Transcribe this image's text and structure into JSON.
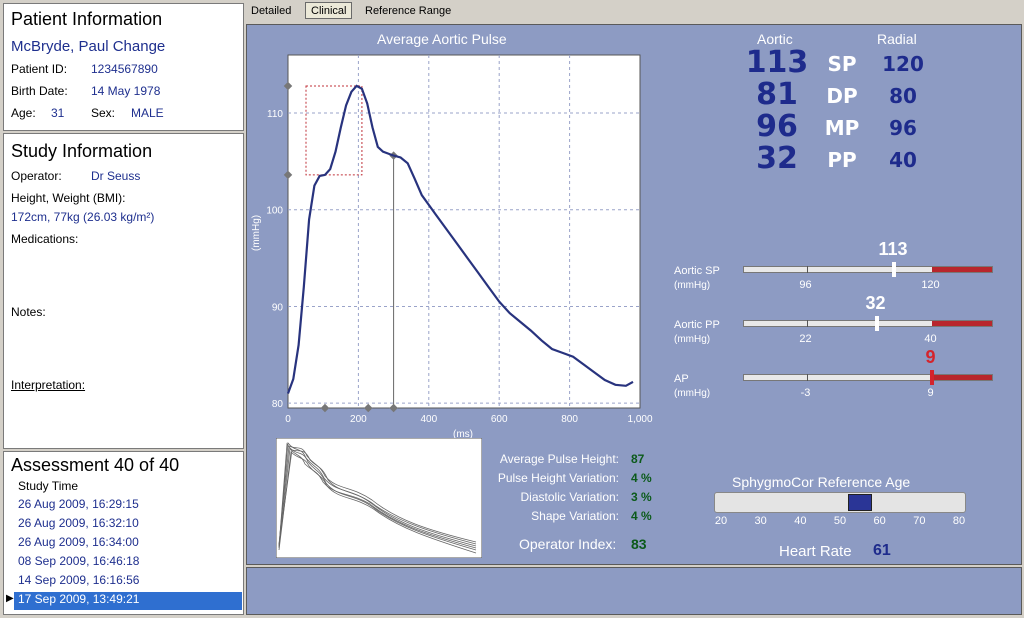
{
  "patient": {
    "title": "Patient Information",
    "name": "McBryde, Paul Change",
    "id_label": "Patient ID:",
    "id_value": "1234567890",
    "birth_label": "Birth Date:",
    "birth_value": "14 May 1978",
    "age_label": "Age:",
    "age_value": "31",
    "sex_label": "Sex:",
    "sex_value": "MALE"
  },
  "study": {
    "title": "Study Information",
    "operator_label": "Operator:",
    "operator_value": "Dr Seuss",
    "hw_label": "Height, Weight (BMI):",
    "hw_value": "172cm, 77kg (26.03 kg/m²)",
    "medications_label": "Medications:",
    "notes_label": "Notes:",
    "interpretation_label": "Interpretation:"
  },
  "assessment": {
    "title": "Assessment 40 of 40",
    "column": "Study Time",
    "rows": [
      "26 Aug 2009, 16:29:15",
      "26 Aug 2009, 16:32:10",
      "26 Aug 2009, 16:34:00",
      "08 Sep 2009, 16:46:18",
      "14 Sep 2009, 16:16:56",
      "17 Sep 2009, 13:49:21"
    ],
    "selected_index": 5
  },
  "tabs": [
    "Detailed",
    "Clinical",
    "Reference Range"
  ],
  "active_tab": 1,
  "chart_data": {
    "type": "line",
    "title": "Average Aortic Pulse",
    "ylabel": "(mmHg)",
    "xlabel": "(ms)",
    "xlim": [
      0,
      1000
    ],
    "ylim": [
      79.5,
      116
    ],
    "xticks": [
      "0",
      "200",
      "400",
      "600",
      "800",
      "1,000"
    ],
    "yticks": [
      "80",
      "90",
      "100",
      "110"
    ],
    "grid": true,
    "series": [
      {
        "x": [
          0,
          15,
          30,
          45,
          60,
          75,
          90,
          105,
          120,
          135,
          150,
          165,
          180,
          195,
          210,
          225,
          240,
          255,
          270,
          285,
          300,
          320,
          340,
          360,
          380,
          400,
          420,
          450,
          480,
          510,
          540,
          570,
          600,
          630,
          660,
          690,
          720,
          750,
          780,
          810,
          840,
          870,
          900,
          930,
          960,
          980
        ],
        "values": [
          81,
          82.5,
          86,
          92,
          99,
          102.5,
          103.5,
          103.6,
          104.2,
          106,
          108.5,
          110.8,
          112.2,
          112.8,
          112.5,
          111,
          108.5,
          106.5,
          106,
          105.8,
          105.6,
          105.4,
          104.8,
          103.2,
          101.5,
          100.5,
          99.5,
          98,
          96.5,
          95,
          93.5,
          92,
          90.5,
          89.3,
          88.4,
          87.5,
          86.5,
          85.6,
          85.2,
          84.8,
          84.0,
          83.2,
          82.4,
          81.9,
          81.8,
          82.2
        ]
      }
    ]
  },
  "aortic_header": "Aortic",
  "radial_header": "Radial",
  "pressures": [
    {
      "label": "SP",
      "aortic": "113",
      "radial": "120"
    },
    {
      "label": "DP",
      "aortic": "81",
      "radial": "80"
    },
    {
      "label": "MP",
      "aortic": "96",
      "radial": "96"
    },
    {
      "label": "PP",
      "aortic": "32",
      "radial": "40"
    }
  ],
  "gauges": [
    {
      "label": "Aortic SP",
      "unit": "(mmHg)",
      "value": "113",
      "tick1": "96",
      "tick2": "120",
      "marker_fraction": 0.6,
      "color": "#ffffff"
    },
    {
      "label": "Aortic PP",
      "unit": "(mmHg)",
      "value": "32",
      "tick1": "22",
      "tick2": "40",
      "marker_fraction": 0.53,
      "color": "#ffffff"
    },
    {
      "label": "AP",
      "unit": "(mmHg)",
      "value": "9",
      "tick1": "-3",
      "tick2": "9",
      "marker_fraction": 0.75,
      "color": "#d4242c"
    }
  ],
  "stats": [
    {
      "label": "Average Pulse Height:",
      "value": "87"
    },
    {
      "label": "Pulse Height Variation:",
      "value": "4 %"
    },
    {
      "label": "Diastolic Variation:",
      "value": "3 %"
    },
    {
      "label": "Shape Variation:",
      "value": "4 %"
    }
  ],
  "operator_index_label": "Operator Index:",
  "operator_index_value": "83",
  "ref_age": {
    "title": "SphygmoCor Reference Age",
    "ticks": [
      "20",
      "30",
      "40",
      "50",
      "60",
      "70",
      "80"
    ],
    "value_fraction": 0.58
  },
  "heart_rate_label": "Heart Rate",
  "heart_rate_value": "61"
}
